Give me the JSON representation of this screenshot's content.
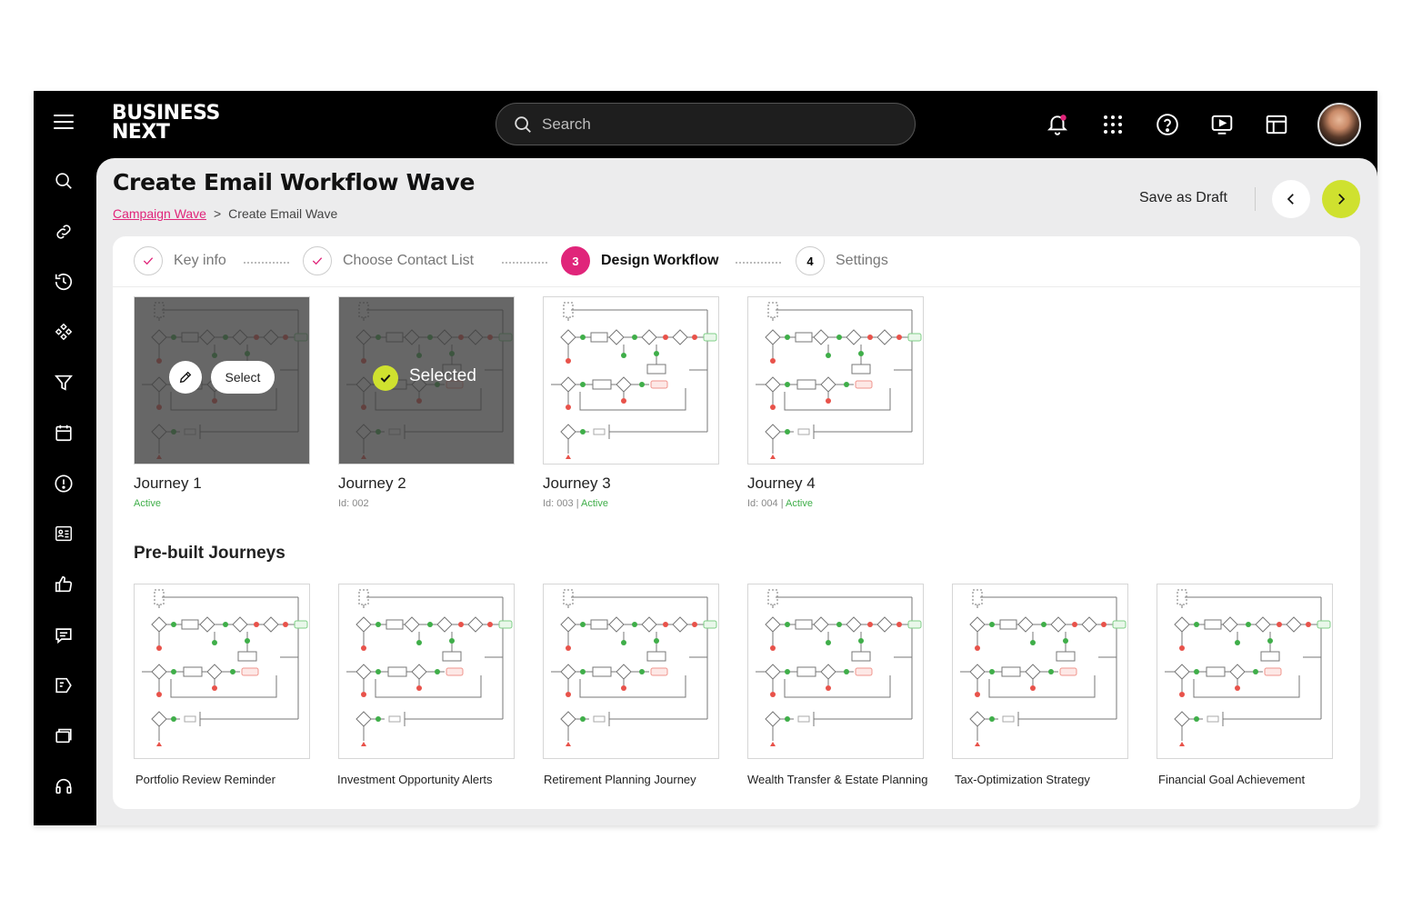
{
  "brand": {
    "line1": "BUSINESS",
    "line2": "NEXT"
  },
  "search": {
    "placeholder": "Search"
  },
  "top_icons": [
    "bell-icon",
    "apps-grid-icon",
    "help-icon",
    "play-screen-icon",
    "layout-icon"
  ],
  "nav_icons": [
    "search-icon",
    "link-icon",
    "history-icon",
    "modules-icon",
    "filter-icon",
    "calendar-icon",
    "alert-icon",
    "contact-card-icon",
    "thumbs-up-icon",
    "chat-icon",
    "campaign-icon",
    "stack-icon",
    "headset-icon"
  ],
  "page": {
    "title": "Create Email Workflow Wave",
    "breadcrumb": {
      "link": "Campaign Wave",
      "separator": ">",
      "current": "Create Email Wave"
    },
    "save_draft": "Save as Draft"
  },
  "steps": [
    {
      "label": "Key info",
      "state": "done"
    },
    {
      "label": "Choose Contact List",
      "state": "done"
    },
    {
      "number": "3",
      "label": "Design Workflow",
      "state": "active"
    },
    {
      "number": "4",
      "label": "Settings",
      "state": "pending"
    }
  ],
  "journeys": [
    {
      "name": "Journey 1",
      "id": "",
      "status": "Active",
      "hover_action": "Select"
    },
    {
      "name": "Journey 2",
      "id": "Id: 002",
      "status": "",
      "selected_label": "Selected"
    },
    {
      "name": "Journey 3",
      "id": "Id: 003",
      "sep": " | ",
      "status": "Active"
    },
    {
      "name": "Journey 4",
      "id": "Id: 004",
      "sep": " | ",
      "status": "Active"
    }
  ],
  "prebuilt": {
    "title": "Pre-built Journeys",
    "items": [
      "Portfolio Review Reminder",
      "Investment Opportunity Alerts",
      "Retirement Planning Journey",
      "Wealth Transfer & Estate Planning",
      "Tax-Optimization Strategy",
      "Financial Goal Achievement"
    ]
  },
  "colors": {
    "accent": "#e0257a",
    "lime": "#cfe12f",
    "active_green": "#3fae49",
    "dark": "#000000"
  }
}
